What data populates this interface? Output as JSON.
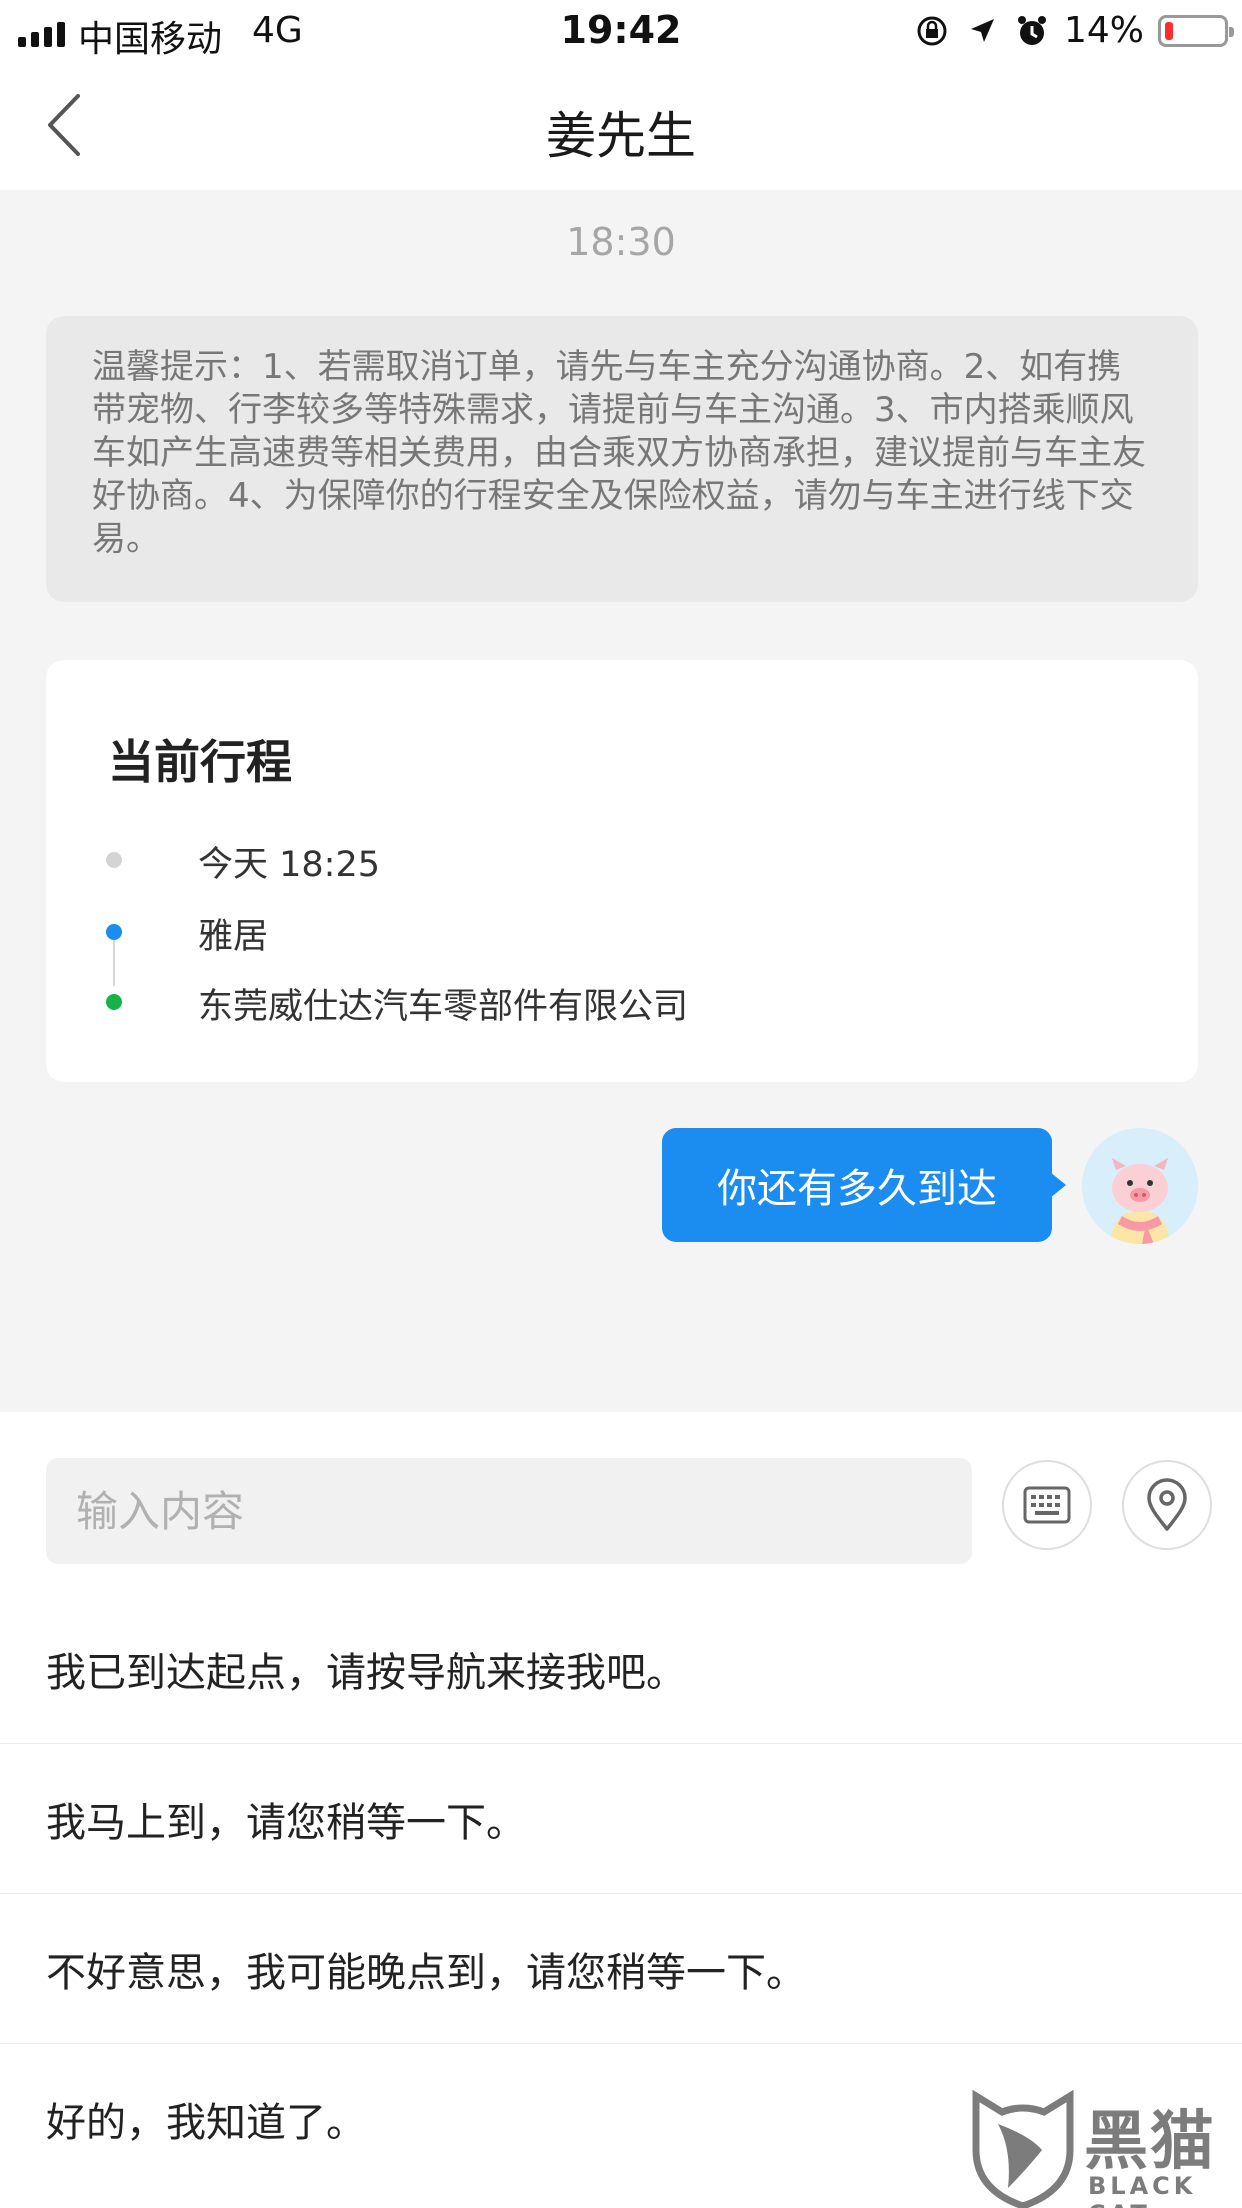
{
  "status_bar": {
    "carrier": "中国移动",
    "network": "4G",
    "time": "19:42",
    "battery_text": "14%",
    "battery_level": 0.14,
    "battery_color": "#ff2d2d",
    "icons": [
      "rotation-lock-icon",
      "location-arrow-icon",
      "alarm-icon",
      "battery-icon"
    ]
  },
  "header": {
    "title": "姜先生",
    "back_icon": "chevron-left-icon"
  },
  "chat": {
    "timestamp": "18:30",
    "tips": "温馨提示：1、若需取消订单，请先与车主充分沟通协商。2、如有携带宠物、行李较多等特殊需求，请提前与车主沟通。3、市内搭乘顺风车如产生高速费等相关费用，由合乘双方协商承担，建议提前与车主友好协商。4、为保障你的行程安全及保险权益，请勿与车主进行线下交易。",
    "trip": {
      "title": "当前行程",
      "time": "今天 18:25",
      "from": "雅居",
      "to": "东莞威仕达汽车零部件有限公司"
    },
    "message": "你还有多久到达"
  },
  "input": {
    "placeholder": "输入内容",
    "value": ""
  },
  "quick_replies": [
    "我已到达起点，请按导航来接我吧。",
    "我马上到，请您稍等一下。",
    "不好意思，我可能晚点到，请您稍等一下。",
    "好的，我知道了。"
  ],
  "watermark": {
    "text": "黑猫",
    "sub": "BLACK CAT"
  },
  "colors": {
    "accent": "#1b8cf0",
    "from_dot": "#1b8cf0",
    "to_dot": "#16b34a",
    "time_dot": "#d4d4d4"
  }
}
